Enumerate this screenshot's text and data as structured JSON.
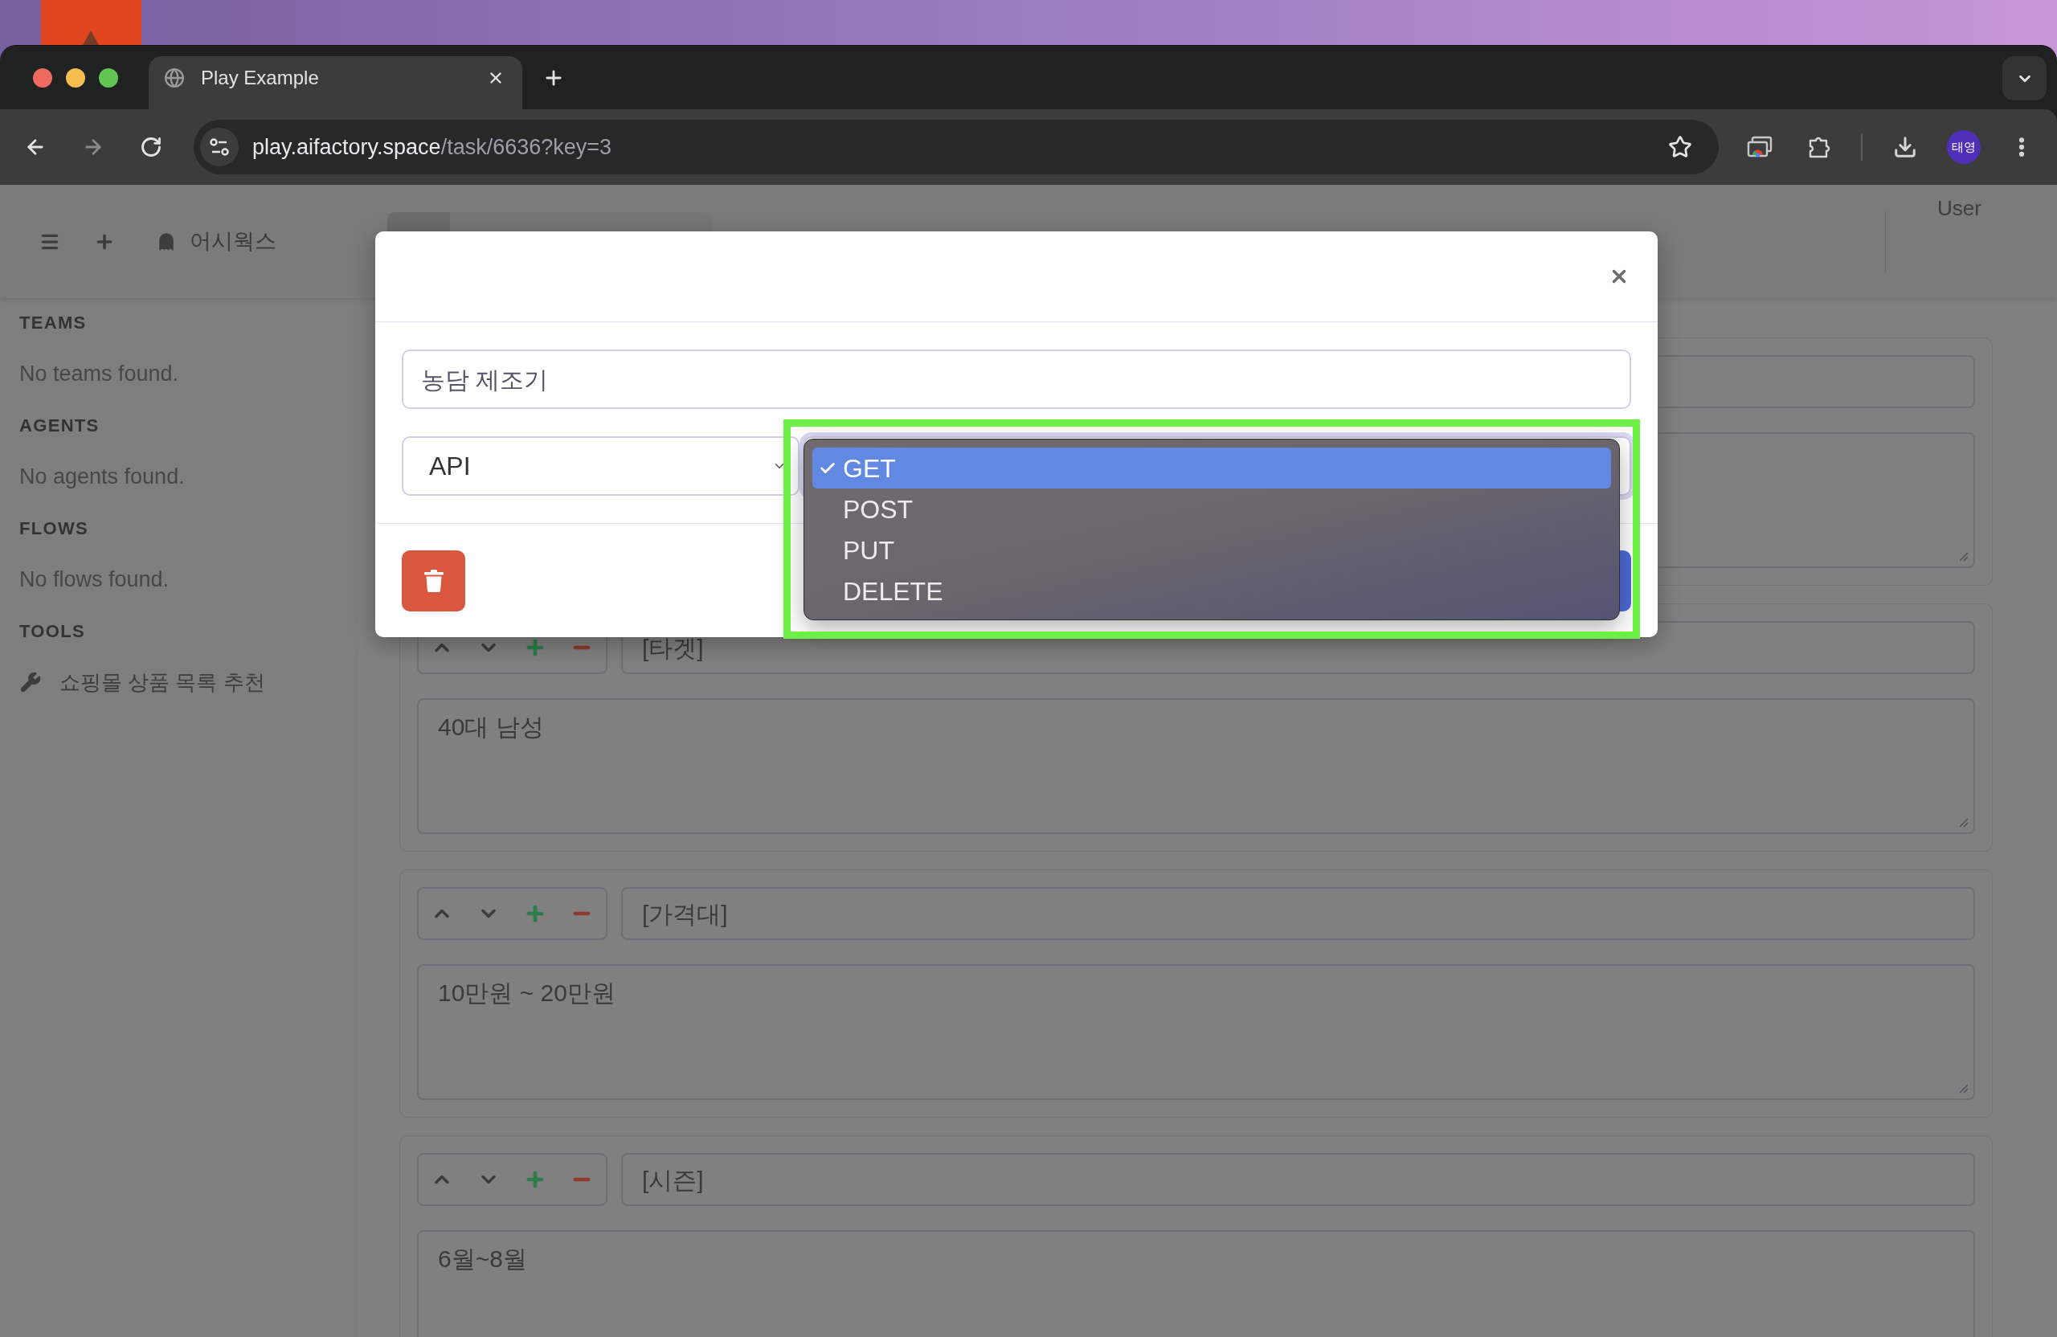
{
  "browser": {
    "tab": {
      "title": "Play Example"
    },
    "address": {
      "host": "play.aifactory.space",
      "path": "/task/6636?key=3"
    },
    "profile": {
      "initials": "태영"
    }
  },
  "header": {
    "workspace": "어시웍스",
    "user": "User"
  },
  "sidebar": {
    "sections": [
      {
        "title": "TEAMS",
        "entries": [
          {
            "kind": "empty",
            "label": "No teams found."
          }
        ]
      },
      {
        "title": "AGENTS",
        "entries": [
          {
            "kind": "empty",
            "label": "No agents found."
          }
        ]
      },
      {
        "title": "FLOWS",
        "entries": [
          {
            "kind": "empty",
            "label": "No flows found."
          }
        ]
      },
      {
        "title": "TOOLS",
        "entries": [
          {
            "kind": "tool",
            "label": "쇼핑몰 상품 목록 추천"
          }
        ]
      }
    ]
  },
  "blocks": [
    {
      "title": "[타겟]",
      "body": "40대 남성"
    },
    {
      "title": "[가격대]",
      "body": "10만원 ~ 20만원"
    },
    {
      "title": "[시즌]",
      "body": "6월~8월"
    }
  ],
  "modal": {
    "name_field": {
      "value": "농담 제조기"
    },
    "type_select": {
      "value": "API"
    },
    "method_menu": {
      "options": [
        {
          "label": "GET",
          "selected": true
        },
        {
          "label": "POST",
          "selected": false
        },
        {
          "label": "PUT",
          "selected": false
        },
        {
          "label": "DELETE",
          "selected": false
        }
      ]
    }
  }
}
